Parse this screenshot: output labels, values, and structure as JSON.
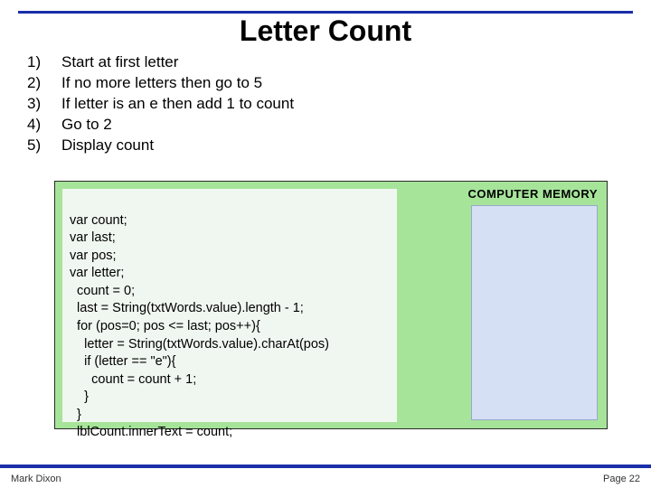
{
  "title": "Letter Count",
  "steps": [
    {
      "n": "1)",
      "text": "Start at first letter"
    },
    {
      "n": "2)",
      "text": "If no more letters then go to 5"
    },
    {
      "n": "3)",
      "text": "If letter is an e then add 1 to count"
    },
    {
      "n": "4)",
      "text": "Go to 2"
    },
    {
      "n": "5)",
      "text": "Display count"
    }
  ],
  "code_lines": [
    "var count;",
    "var last;",
    "var pos;",
    "var letter;",
    "  count = 0;",
    "  last = String(txtWords.value).length - 1;",
    "  for (pos=0; pos <= last; pos++){",
    "    letter = String(txtWords.value).charAt(pos)",
    "    if (letter == \"e\"){",
    "      count = count + 1;",
    "    }",
    "  }",
    "  lblCount.innerText = count;"
  ],
  "memory_label": "COMPUTER MEMORY",
  "footer": {
    "left": "Mark Dixon",
    "right": "Page 22"
  }
}
